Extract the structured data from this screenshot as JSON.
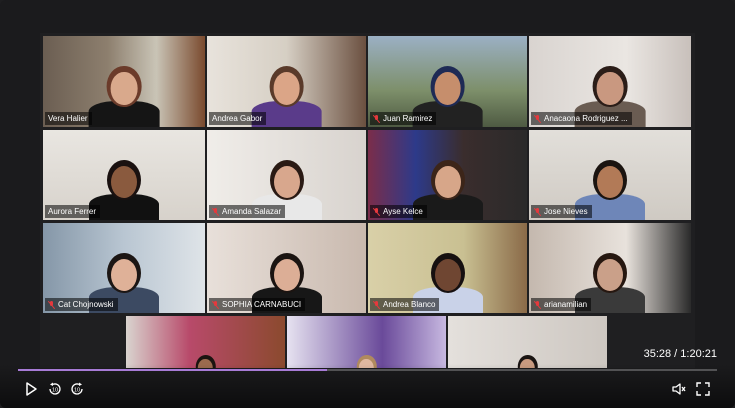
{
  "participants": [
    {
      "name": "Vera Halier",
      "muted": false,
      "active": true
    },
    {
      "name": "Andrea Gabor",
      "muted": false,
      "active": false
    },
    {
      "name": "Juan Ramirez",
      "muted": true,
      "active": false
    },
    {
      "name": "Anacaona Rodriguez ...",
      "muted": true,
      "active": false
    },
    {
      "name": "Aurora Ferrer",
      "muted": false,
      "active": false
    },
    {
      "name": "Amanda Salazar",
      "muted": true,
      "active": false
    },
    {
      "name": "Ayse Kelce",
      "muted": true,
      "active": false
    },
    {
      "name": "Jose Nieves",
      "muted": true,
      "active": false
    },
    {
      "name": "Cat Chojnowski",
      "muted": true,
      "active": false
    },
    {
      "name": "SOPHIA CARNABUCI",
      "muted": true,
      "active": false
    },
    {
      "name": "Andrea Blanco",
      "muted": true,
      "active": false
    },
    {
      "name": "arianamilian",
      "muted": true,
      "active": false
    },
    {
      "name": "",
      "muted": false,
      "active": false
    },
    {
      "name": "",
      "muted": false,
      "active": false
    },
    {
      "name": "",
      "muted": false,
      "active": false
    }
  ],
  "player": {
    "time_display": "35:28 / 1:20:21",
    "progress": 0.442,
    "accent_color": "#a77bd6",
    "controls": [
      "play-icon",
      "rewind-10-icon",
      "forward-10-icon",
      "volume-icon",
      "fullscreen-icon"
    ]
  }
}
